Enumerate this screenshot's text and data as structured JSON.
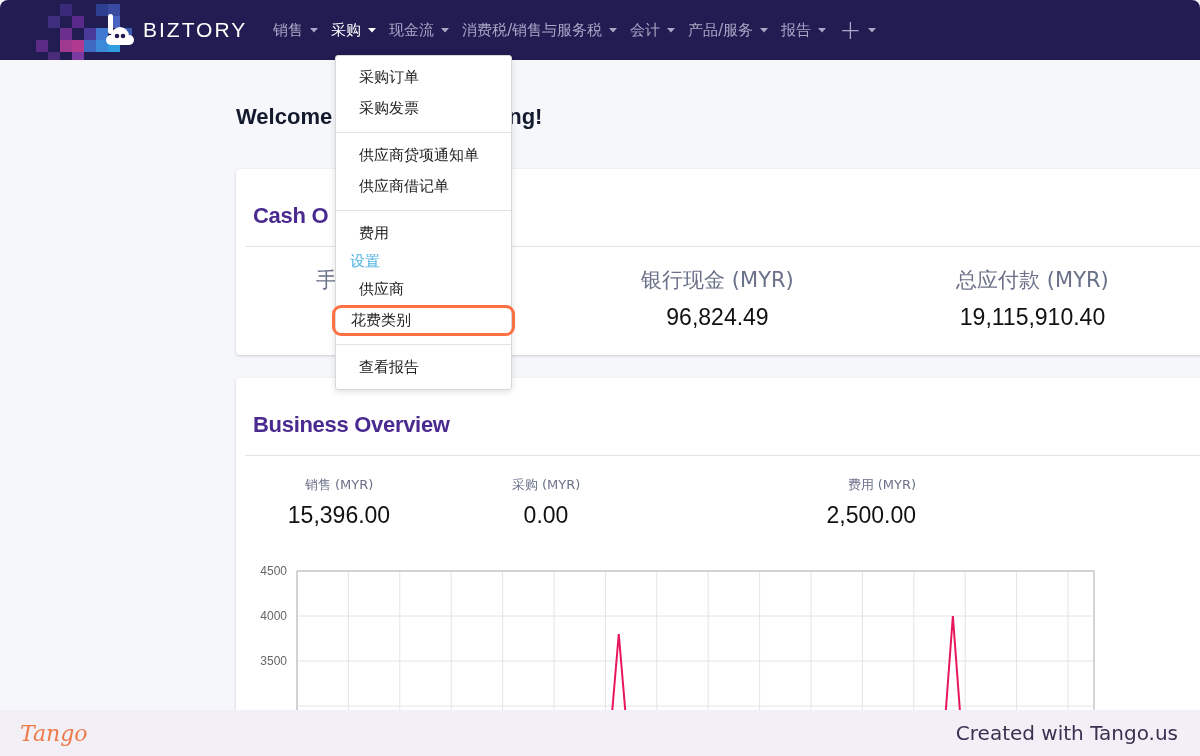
{
  "nav": {
    "brand": "BIZTORY",
    "items": [
      {
        "label": "销售",
        "selected": false,
        "kind": "text"
      },
      {
        "label": "采购",
        "selected": true,
        "kind": "text"
      },
      {
        "label": "现金流",
        "selected": false,
        "kind": "text"
      },
      {
        "label": "消费税/销售与服务税",
        "selected": false,
        "kind": "text"
      },
      {
        "label": "会计",
        "selected": false,
        "kind": "text"
      },
      {
        "label": "产品/服务",
        "selected": false,
        "kind": "text"
      },
      {
        "label": "报告",
        "selected": false,
        "kind": "text"
      },
      {
        "label": "+",
        "selected": false,
        "kind": "plus"
      }
    ]
  },
  "dropdown": {
    "groups": [
      {
        "items": [
          {
            "kind": "link",
            "label": "采购订单",
            "highlighted": false
          },
          {
            "kind": "link",
            "label": "采购发票",
            "highlighted": false
          }
        ]
      },
      {
        "items": [
          {
            "kind": "link",
            "label": "供应商贷项通知单",
            "highlighted": false
          },
          {
            "kind": "link",
            "label": "供应商借记单",
            "highlighted": false
          }
        ]
      },
      {
        "items": [
          {
            "kind": "link",
            "label": "费用",
            "highlighted": false
          },
          {
            "kind": "header",
            "label": "设置"
          },
          {
            "kind": "link",
            "label": "供应商",
            "highlighted": false
          },
          {
            "kind": "link",
            "label": "花费类别",
            "highlighted": true
          }
        ]
      },
      {
        "items": [
          {
            "kind": "link",
            "label": "查看报告",
            "highlighted": false
          }
        ]
      }
    ]
  },
  "welcome": {
    "left": "Welcome",
    "right": "ng!"
  },
  "cash_overview": {
    "title": "Cash O",
    "stats": [
      {
        "label": "手"
      },
      {
        "label": "银行现金 (MYR)",
        "value": "96,824.49"
      },
      {
        "label": "总应付款 (MYR)",
        "value": "19,115,910.40"
      }
    ]
  },
  "business_overview": {
    "title": "Business Overview",
    "stats": [
      {
        "label": "销售 (MYR)",
        "value": "15,396.00"
      },
      {
        "label": "采购 (MYR)",
        "value": "0.00"
      },
      {
        "label": "费用 (MYR)",
        "value": "2,500.00"
      }
    ],
    "chart": {
      "y_axis_labels": [
        "4500",
        "4000",
        "3500"
      ]
    }
  },
  "footer": {
    "logo": "Tango",
    "credit": "Created with Tango.us"
  }
}
